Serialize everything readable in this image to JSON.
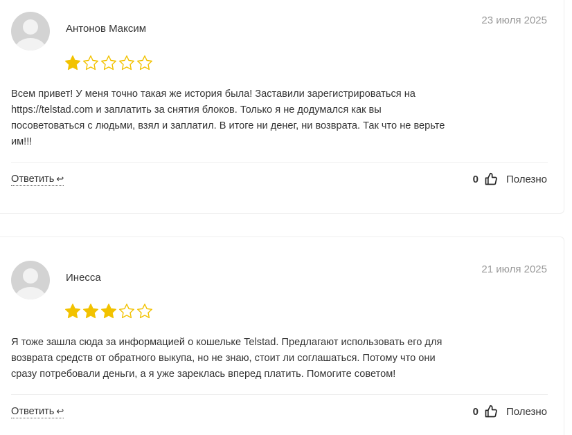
{
  "reviews": [
    {
      "author": "Антонов Максим",
      "date": "23 июля 2025",
      "rating": 1,
      "max_rating": 5,
      "text_lines": [
        "Всем привет! У меня точно такая же история была! Заставили зарегистрироваться на",
        "https://telstad.com и заплатить за снятия блоков. Только я не додумался как вы",
        "посоветоваться с людьми, взял и заплатил. В итоге ни денег, ни возврата. Так что не верьте",
        "им!!!"
      ],
      "reply_label": "Ответить",
      "reply_icon": "↩",
      "helpful_count": "0",
      "helpful_label": "Полезно"
    },
    {
      "author": "Инесса",
      "date": "21 июля 2025",
      "rating": 3,
      "max_rating": 5,
      "text_lines": [
        "Я тоже зашла сюда за информацией о кошельке Telstad. Предлагают использовать его для",
        "возврата средств от обратного выкупа, но не знаю, стоит ли соглашаться. Потому что они",
        "сразу потребовали деньги, а я уже зареклась вперед платить. Помогите советом!"
      ],
      "reply_label": "Ответить",
      "reply_icon": "↩",
      "helpful_count": "0",
      "helpful_label": "Полезно"
    }
  ],
  "colors": {
    "star": "#f2c200",
    "avatar_bg": "#d3d3d3",
    "avatar_fg": "#f2f2f2",
    "date": "#999999",
    "text": "#333333",
    "border": "#eeeeee"
  },
  "icons": {
    "avatar": "user-placeholder-icon",
    "star": "star-icon",
    "reply": "reply-arrow-icon",
    "helpful": "thumbs-up-icon"
  }
}
